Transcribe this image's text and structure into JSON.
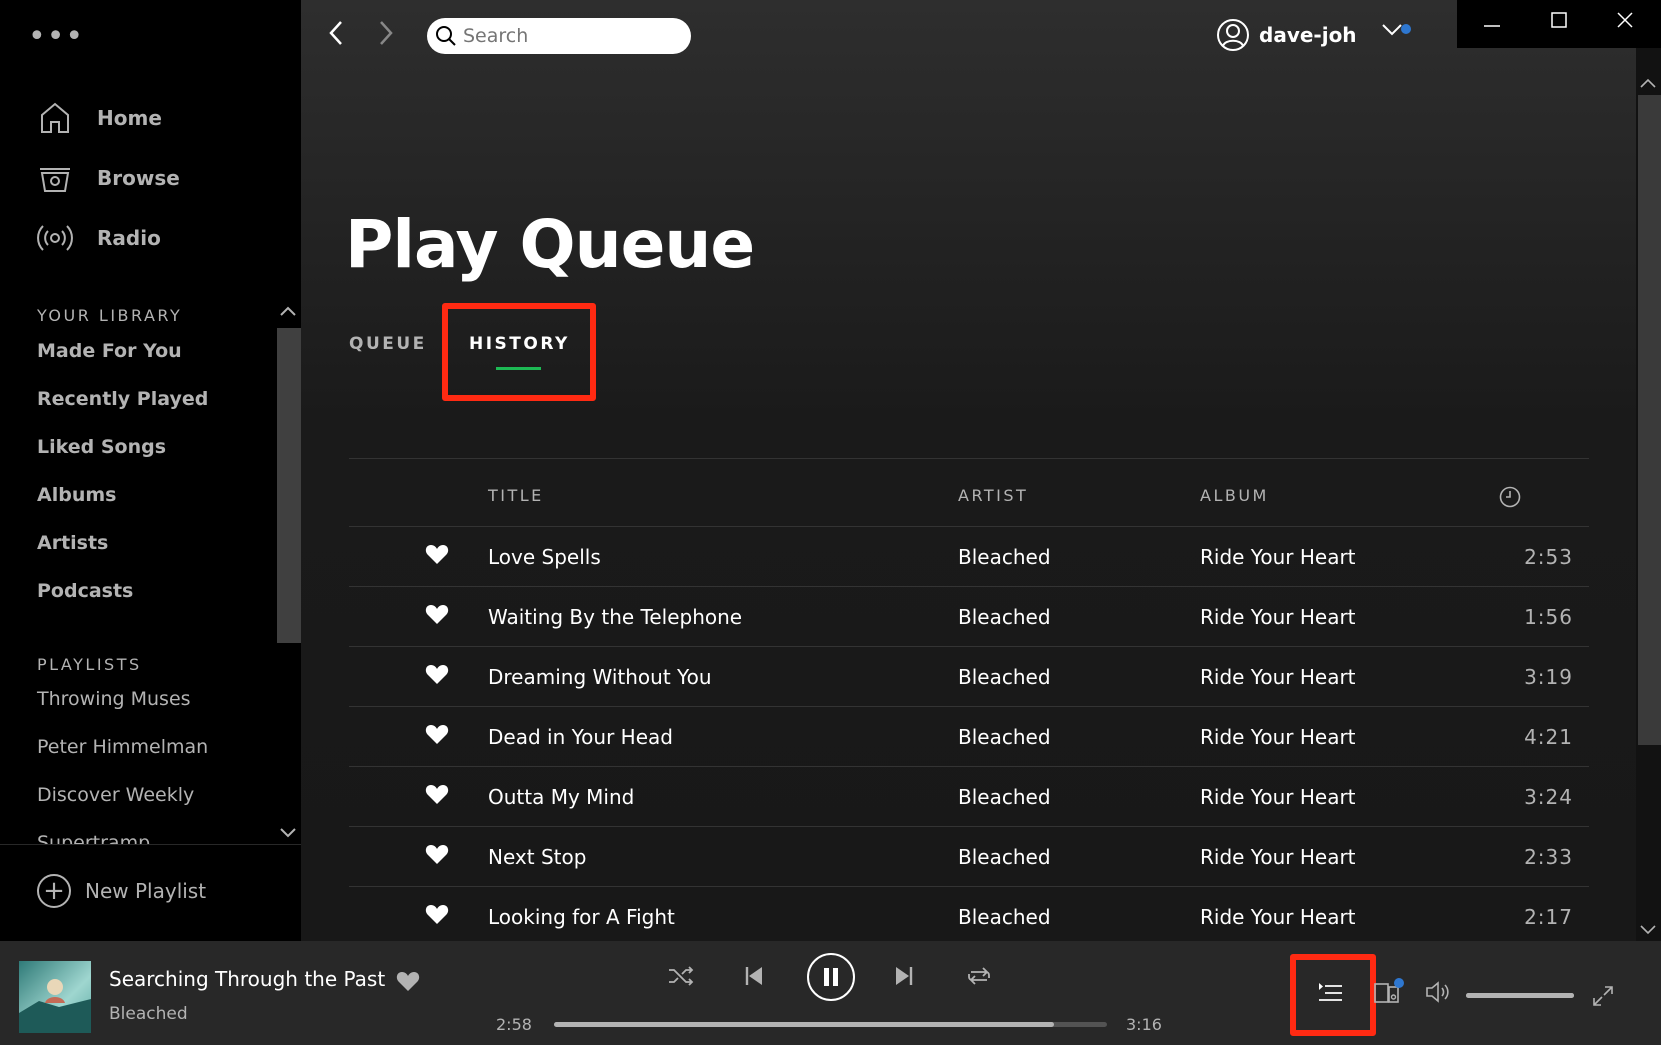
{
  "sidebar": {
    "menu_label": "•••",
    "nav": [
      {
        "label": "Home",
        "icon": "home-icon"
      },
      {
        "label": "Browse",
        "icon": "browse-icon"
      },
      {
        "label": "Radio",
        "icon": "radio-icon"
      }
    ],
    "library_title": "YOUR LIBRARY",
    "library_items": [
      "Made For You",
      "Recently Played",
      "Liked Songs",
      "Albums",
      "Artists",
      "Podcasts"
    ],
    "playlists_title": "PLAYLISTS",
    "playlists": [
      "Throwing Muses",
      "Peter Himmelman",
      "Discover Weekly",
      "Supertramp"
    ],
    "new_playlist": "New Playlist"
  },
  "topbar": {
    "search_placeholder": "Search",
    "username": "dave-joh"
  },
  "page": {
    "title": "Play Queue",
    "tabs": [
      {
        "label": "QUEUE",
        "active": false
      },
      {
        "label": "HISTORY",
        "active": true
      }
    ]
  },
  "table": {
    "headers": {
      "title": "TITLE",
      "artist": "ARTIST",
      "album": "ALBUM",
      "duration_icon": "clock-icon"
    },
    "rows": [
      {
        "title": "Love Spells",
        "artist": "Bleached",
        "album": "Ride Your Heart",
        "duration": "2:53",
        "liked": true
      },
      {
        "title": "Waiting By the Telephone",
        "artist": "Bleached",
        "album": "Ride Your Heart",
        "duration": "1:56",
        "liked": true
      },
      {
        "title": "Dreaming Without You",
        "artist": "Bleached",
        "album": "Ride Your Heart",
        "duration": "3:19",
        "liked": true
      },
      {
        "title": "Dead in Your Head",
        "artist": "Bleached",
        "album": "Ride Your Heart",
        "duration": "4:21",
        "liked": true
      },
      {
        "title": "Outta My Mind",
        "artist": "Bleached",
        "album": "Ride Your Heart",
        "duration": "3:24",
        "liked": true
      },
      {
        "title": "Next Stop",
        "artist": "Bleached",
        "album": "Ride Your Heart",
        "duration": "2:33",
        "liked": true
      },
      {
        "title": "Looking for A Fight",
        "artist": "Bleached",
        "album": "Ride Your Heart",
        "duration": "2:17",
        "liked": true
      }
    ]
  },
  "player": {
    "track_title": "Searching Through the Past",
    "track_artist": "Bleached",
    "elapsed": "2:58",
    "total": "3:16",
    "progress_fraction": 0.905,
    "volume_fraction": 1.0,
    "state": "playing"
  },
  "colors": {
    "accent_green": "#1db954",
    "highlight_red": "#ff2a12",
    "notification_blue": "#2e77d0"
  }
}
